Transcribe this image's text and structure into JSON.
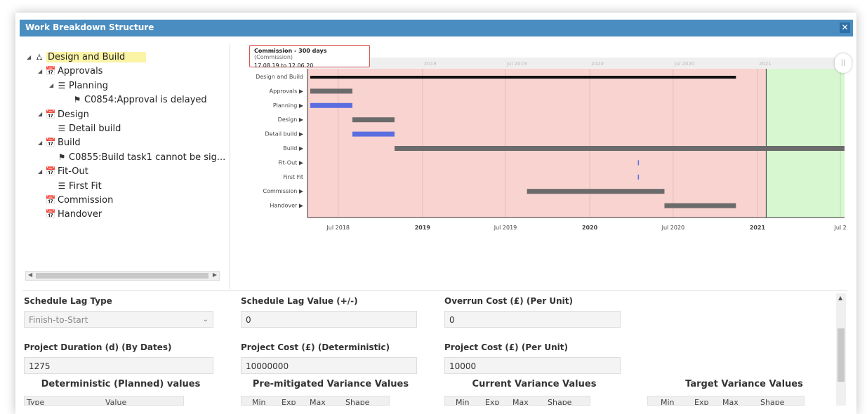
{
  "window": {
    "title": "Work Breakdown Structure",
    "close": "✕"
  },
  "tree": [
    {
      "label": "Design and Build",
      "icon": "hierarchy-icon",
      "glyph": "⛼",
      "level": 0,
      "expanded": true,
      "selected": true
    },
    {
      "label": "Approvals",
      "icon": "calendar-icon",
      "glyph": "📅",
      "level": 1,
      "expanded": true
    },
    {
      "label": "Planning",
      "icon": "task-list-icon",
      "glyph": "☰",
      "level": 2,
      "expanded": true
    },
    {
      "label": "C0854:Approval is delayed",
      "icon": "flag-icon",
      "glyph": "⚑",
      "level": 3
    },
    {
      "label": "Design",
      "icon": "calendar-icon",
      "glyph": "📅",
      "level": 1,
      "expanded": true
    },
    {
      "label": "Detail build",
      "icon": "task-list-icon",
      "glyph": "☰",
      "level": 2
    },
    {
      "label": "Build",
      "icon": "calendar-icon",
      "glyph": "📅",
      "level": 1,
      "expanded": true
    },
    {
      "label": "C0855:Build task1 cannot be sig...",
      "icon": "flag-icon",
      "glyph": "⚑",
      "level": 2
    },
    {
      "label": "Fit-Out",
      "icon": "calendar-icon",
      "glyph": "📅",
      "level": 1,
      "expanded": true
    },
    {
      "label": "First Fit",
      "icon": "task-list-icon",
      "glyph": "☰",
      "level": 2
    },
    {
      "label": "Commission",
      "icon": "calendar-icon",
      "glyph": "📅",
      "level": 1
    },
    {
      "label": "Handover",
      "icon": "calendar-icon",
      "glyph": "📅",
      "level": 1
    }
  ],
  "tooltip": {
    "title": "Commission - 300 days",
    "category": "(Commission)",
    "dates": "17.08.19 to 12.06.20"
  },
  "gantt": {
    "top_axis": [
      "2019",
      "Jul 2019",
      "2020",
      "Jul 2020",
      "2021"
    ],
    "bottom_axis": [
      "Jul 2018",
      "2019",
      "Jul 2019",
      "2020",
      "Jul 2020",
      "2021",
      "Jul 2"
    ],
    "rows": [
      "Design and Build",
      "Approvals ▶",
      "Planning ▶",
      "Design ▶",
      "Detail build ▶",
      "Build ▶",
      "Fit-Out ▶",
      "First Fit",
      "Commission ▶",
      "Handover ▶"
    ],
    "bars": [
      {
        "row": 0,
        "start": "2018-05-01",
        "end": "2020-11-15",
        "color": "#111111"
      },
      {
        "row": 1,
        "start": "2018-05-01",
        "end": "2018-08-01",
        "color": "#6b6b6b"
      },
      {
        "row": 2,
        "start": "2018-05-01",
        "end": "2018-08-01",
        "color": "#5b6ee0"
      },
      {
        "row": 3,
        "start": "2018-08-01",
        "end": "2018-11-01",
        "color": "#6b6b6b"
      },
      {
        "row": 4,
        "start": "2018-08-01",
        "end": "2018-11-01",
        "color": "#5b6ee0"
      },
      {
        "row": 5,
        "start": "2018-11-01",
        "end": "2021-07-10",
        "color": "#6b6b6b"
      },
      {
        "row": 6,
        "start": "2020-04-15",
        "end": "2020-04-17",
        "color": "#5b6ee0"
      },
      {
        "row": 7,
        "start": "2020-04-15",
        "end": "2020-04-17",
        "color": "#5b6ee0"
      },
      {
        "row": 8,
        "start": "2019-08-17",
        "end": "2020-06-12",
        "color": "#6b6b6b"
      },
      {
        "row": 9,
        "start": "2020-06-12",
        "end": "2020-11-15",
        "color": "#6b6b6b"
      }
    ],
    "colors": {
      "past": "#f9d3d0",
      "future": "#d6f7cf"
    }
  },
  "form": {
    "schedule_lag_type": {
      "label": "Schedule Lag Type",
      "value": "Finish-to-Start"
    },
    "schedule_lag_value": {
      "label": "Schedule Lag Value (+/-)",
      "value": "0"
    },
    "overrun_cost": {
      "label": "Overrun Cost (£) (Per Unit)",
      "value": "0"
    },
    "project_duration": {
      "label": "Project Duration (d) (By Dates)",
      "value": "1275"
    },
    "project_cost_det": {
      "label": "Project Cost (£) (Deterministic)",
      "value": "10000000"
    },
    "project_cost_unit": {
      "label": "Project Cost (£) (Per Unit)",
      "value": "10000"
    }
  },
  "sections": {
    "deterministic": {
      "title": "Deterministic (Planned) values",
      "cols": [
        "Type",
        "Value"
      ]
    },
    "pre_mitigated": {
      "title": "Pre-mitigated Variance Values",
      "cols": [
        "Min",
        "Exp",
        "Max",
        "Shape"
      ]
    },
    "current": {
      "title": "Current Variance Values",
      "cols": [
        "Min",
        "Exp",
        "Max",
        "Shape"
      ]
    },
    "target": {
      "title": "Target Variance Values",
      "cols": [
        "Min",
        "Exp",
        "Max",
        "Shape"
      ]
    }
  }
}
